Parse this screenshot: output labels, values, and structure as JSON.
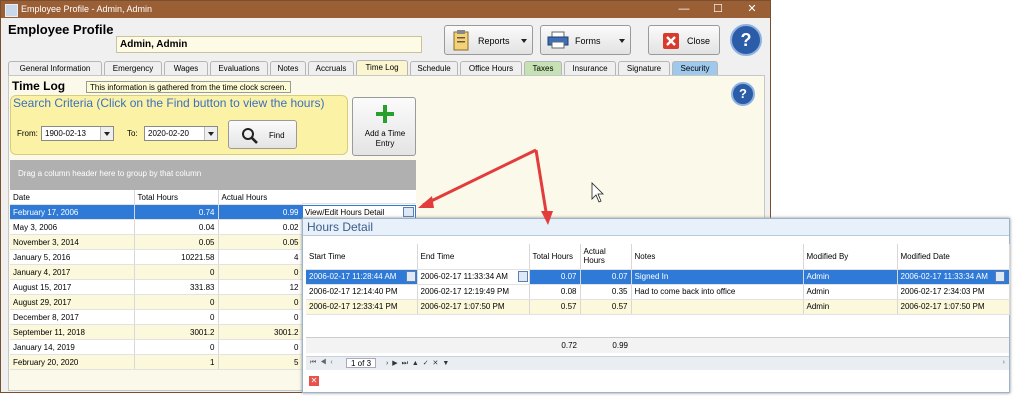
{
  "window": {
    "title": "Employee Profile - Admin, Admin",
    "minimize": "—",
    "maximize": "☐",
    "close": "✕"
  },
  "header": {
    "title": "Employee Profile",
    "employee_name": "Admin, Admin"
  },
  "toolbar": {
    "reports_label": "Reports",
    "forms_label": "Forms",
    "close_label": "Close",
    "help_icon": "?"
  },
  "tabs": [
    {
      "label": "General Information"
    },
    {
      "label": "Emergency"
    },
    {
      "label": "Wages"
    },
    {
      "label": "Evaluations"
    },
    {
      "label": "Notes"
    },
    {
      "label": "Accruals"
    },
    {
      "label": "Time Log"
    },
    {
      "label": "Schedule"
    },
    {
      "label": "Office Hours"
    },
    {
      "label": "Taxes"
    },
    {
      "label": "Insurance"
    },
    {
      "label": "Signature"
    },
    {
      "label": "Security"
    }
  ],
  "timelog": {
    "title": "Time Log",
    "info": "This information is gathered from the time clock screen.",
    "search_title": "Search Criteria (Click on the Find button to view the hours)",
    "from_label": "From:",
    "from_value": "1900-02-13",
    "to_label": "To:",
    "to_value": "2020-02-20",
    "find_label": "Find",
    "add_label": "Add a Time Entry",
    "group_hint": "Drag a column header here to group by that column",
    "columns": [
      "Date",
      "Total Hours",
      "Actual Hours"
    ],
    "detail_link": "View/Edit Hours Detail",
    "rows": [
      {
        "date": "February 17, 2006",
        "total": "0.74",
        "actual": "0.99"
      },
      {
        "date": "May 3, 2006",
        "total": "0.04",
        "actual": "0.02"
      },
      {
        "date": "November 3, 2014",
        "total": "0.05",
        "actual": "0.05"
      },
      {
        "date": "January 5, 2016",
        "total": "10221.58",
        "actual": "4"
      },
      {
        "date": "January 4, 2017",
        "total": "0",
        "actual": "0"
      },
      {
        "date": "August 15, 2017",
        "total": "331.83",
        "actual": "12"
      },
      {
        "date": "August 29, 2017",
        "total": "0",
        "actual": "0"
      },
      {
        "date": "December 8, 2017",
        "total": "0",
        "actual": "0"
      },
      {
        "date": "September 11, 2018",
        "total": "3001.2",
        "actual": "3001.2"
      },
      {
        "date": "January 14, 2019",
        "total": "0",
        "actual": "0"
      },
      {
        "date": "February 20, 2020",
        "total": "1",
        "actual": "5"
      }
    ]
  },
  "hours_detail": {
    "title": "Hours Detail",
    "columns": [
      "Start Time",
      "End Time",
      "Total Hours",
      "Actual Hours",
      "Notes",
      "Modified By",
      "Modified Date"
    ],
    "rows": [
      {
        "start": "2006-02-17 11:28:44 AM",
        "end": "2006-02-17 11:33:34 AM",
        "total": "0.07",
        "actual": "0.07",
        "notes": "Signed In",
        "by": "Admin",
        "date": "2006-02-17 11:33:34 AM"
      },
      {
        "start": "2006-02-17 12:14:40 PM",
        "end": "2006-02-17 12:19:49 PM",
        "total": "0.08",
        "actual": "0.35",
        "notes": "Had to come back into office",
        "by": "Admin",
        "date": "2006-02-17 2:34:03 PM"
      },
      {
        "start": "2006-02-17 12:33:41 PM",
        "end": "2006-02-17 1:07:50 PM",
        "total": "0.57",
        "actual": "0.57",
        "notes": "",
        "by": "Admin",
        "date": "2006-02-17 1:07:50 PM"
      }
    ],
    "sum_total": "0.72",
    "sum_actual": "0.99",
    "pager_text": "1 of 3"
  },
  "colors": {
    "selected": "#2f7ad6",
    "arrow": "#e23c3c",
    "title_bar": "#9b5f35"
  }
}
